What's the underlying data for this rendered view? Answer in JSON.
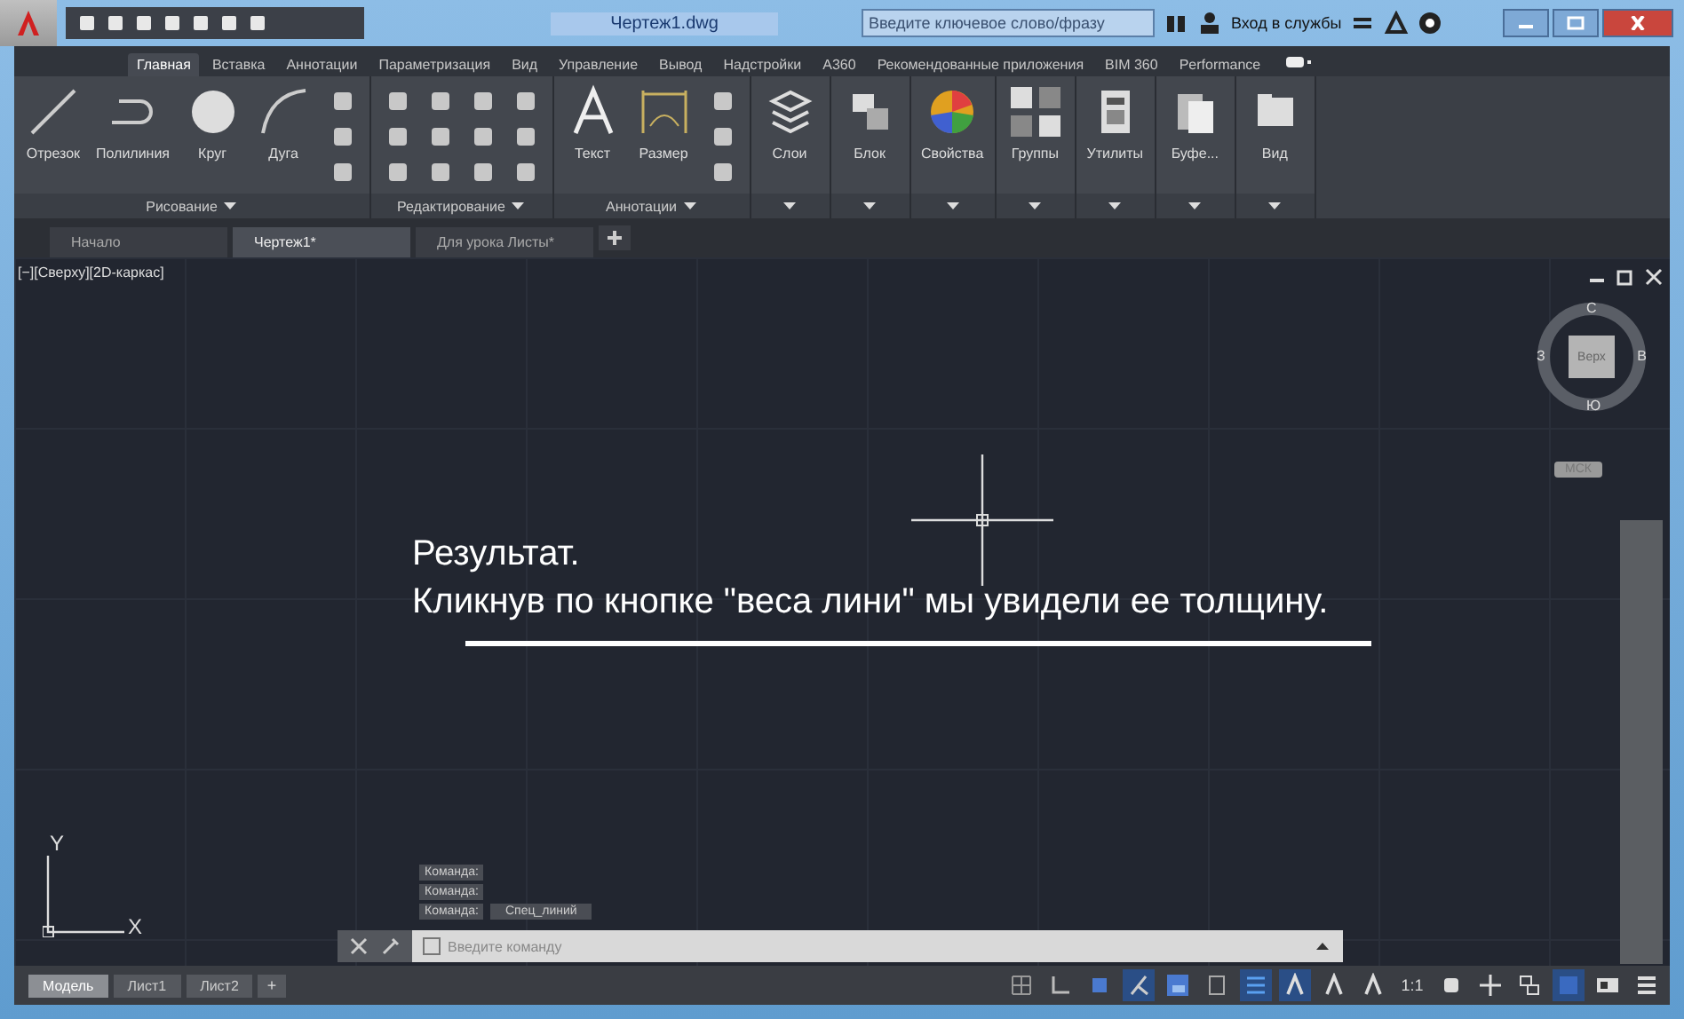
{
  "window": {
    "title": "Чертеж1.dwg"
  },
  "search": {
    "placeholder": "Введите ключевое слово/фразу"
  },
  "sign_in": {
    "label": "Вход в службы"
  },
  "ribbon_tabs": [
    {
      "label": "Главная",
      "selected": true
    },
    {
      "label": "Вставка",
      "selected": false
    },
    {
      "label": "Аннотации",
      "selected": false
    },
    {
      "label": "Параметризация",
      "selected": false
    },
    {
      "label": "Вид",
      "selected": false
    },
    {
      "label": "Управление",
      "selected": false
    },
    {
      "label": "Вывод",
      "selected": false
    },
    {
      "label": "Надстройки",
      "selected": false
    },
    {
      "label": "A360",
      "selected": false
    },
    {
      "label": "Рекомендованные приложения",
      "selected": false
    },
    {
      "label": "BIM 360",
      "selected": false
    },
    {
      "label": "Performance",
      "selected": false
    }
  ],
  "ribbon_panels": [
    {
      "title": "Рисование",
      "tools": [
        {
          "label": "Отрезок",
          "kind": "line"
        },
        {
          "label": "Полилиния",
          "kind": "polyline"
        },
        {
          "label": "Круг",
          "kind": "circle"
        },
        {
          "label": "Дуга",
          "kind": "arc"
        }
      ]
    },
    {
      "title": "Редактирование"
    },
    {
      "title": "Аннотации",
      "tools": [
        {
          "label": "Текст",
          "kind": "text"
        },
        {
          "label": "Размер",
          "kind": "dimension"
        }
      ]
    },
    {
      "tools": [
        {
          "label": "Слои",
          "kind": "layers"
        }
      ]
    },
    {
      "tools": [
        {
          "label": "Блок",
          "kind": "block"
        }
      ]
    },
    {
      "tools": [
        {
          "label": "Свойства",
          "kind": "properties"
        }
      ]
    },
    {
      "tools": [
        {
          "label": "Группы",
          "kind": "groups"
        }
      ]
    },
    {
      "tools": [
        {
          "label": "Утилиты",
          "kind": "utilities"
        }
      ]
    },
    {
      "tools": [
        {
          "label": "Буфе...",
          "kind": "clipboard"
        }
      ]
    },
    {
      "tools": [
        {
          "label": "Вид",
          "kind": "view"
        }
      ]
    }
  ],
  "document_tabs": [
    {
      "label": "Начало",
      "selected": false
    },
    {
      "label": "Чертеж1*",
      "selected": true
    },
    {
      "label": "Для урока Листы*",
      "selected": false
    }
  ],
  "viewport": {
    "label": "[−][Сверху][2D-каркас]"
  },
  "viewcube": {
    "north": "С",
    "west": "З",
    "east": "В",
    "south": "Ю",
    "face": "Верх",
    "ucs": "МСК"
  },
  "caption": [
    "Результат.",
    "Кликнув по кнопке \"веса лини\" мы увидели ее толщину."
  ],
  "ucs_axes": {
    "x": "X",
    "y": "Y"
  },
  "command_history": [
    "Команда:",
    "Команда:",
    "Команда:"
  ],
  "command_option": "Спец_линий",
  "command_line": {
    "placeholder": "Введите команду"
  },
  "layout_tabs": [
    {
      "label": "Модель",
      "selected": true
    },
    {
      "label": "Лист1",
      "selected": false
    },
    {
      "label": "Лист2",
      "selected": false
    }
  ],
  "layout_add": "+",
  "status_bar": [
    {
      "kind": "grid",
      "on": false
    },
    {
      "kind": "snap",
      "on": false
    },
    {
      "kind": "ortho",
      "on": false
    },
    {
      "kind": "polar",
      "on": true
    },
    {
      "kind": "osnap",
      "on": false
    },
    {
      "kind": "otrack",
      "on": false
    },
    {
      "kind": "lineweight",
      "on": true
    },
    {
      "kind": "annot",
      "on": true
    },
    {
      "kind": "annot",
      "on": false
    },
    {
      "kind": "annot",
      "on": false
    },
    {
      "kind": "scale",
      "label": "1:1",
      "on": false
    },
    {
      "kind": "gear",
      "on": false
    },
    {
      "kind": "plus",
      "on": false
    },
    {
      "kind": "isolate",
      "on": false
    },
    {
      "kind": "hardware",
      "on": true
    },
    {
      "kind": "clean",
      "on": false
    },
    {
      "kind": "menu",
      "on": false
    }
  ]
}
